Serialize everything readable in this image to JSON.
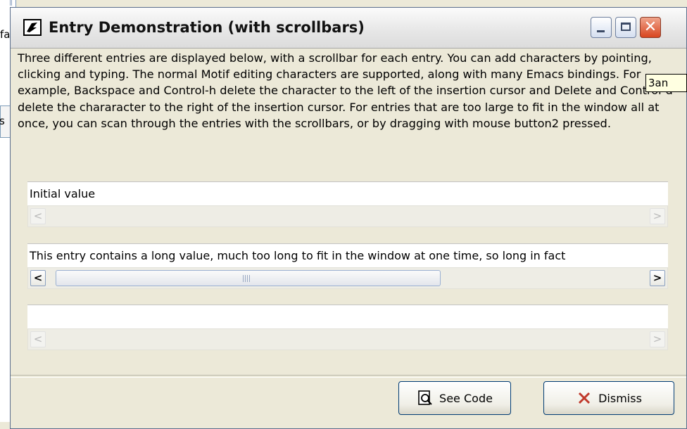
{
  "background_app": {
    "fragment_fa": "fa",
    "fragment_s": "s"
  },
  "window": {
    "title": "Entry Demonstration (with scrollbars)",
    "close_glyph": "✕"
  },
  "description": "Three different entries are displayed below, with a scrollbar for each entry.  You can add characters by pointing, clicking and typing.  The normal Motif editing characters are supported, along with many Emacs bindings.  For example, Backspace and Control-h delete the character to the left of the insertion cursor and Delete and Control-d delete the chararacter to the right of the insertion cursor.  For entries that are too large to fit in the window all at once, you can scan through the entries with the scrollbars, or by dragging with mouse button2 pressed.",
  "entries": [
    {
      "value": "Initial value"
    },
    {
      "value": "This entry contains a long value, much too long to fit in the window at one time, so long in fact"
    },
    {
      "value": ""
    }
  ],
  "scrollbar_glyphs": {
    "left": "<",
    "right": ">"
  },
  "buttons": {
    "see_code": "See Code",
    "dismiss": "Dismiss"
  },
  "tooltip": "3an",
  "colors": {
    "dismiss_x": "#c0392b",
    "button_border": "#003c74"
  }
}
